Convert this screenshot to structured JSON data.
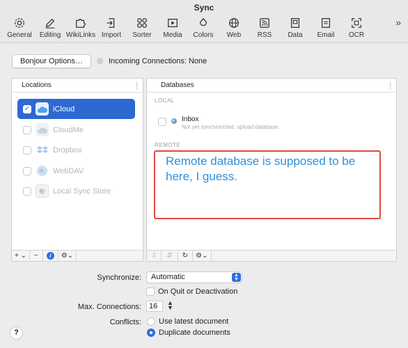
{
  "window": {
    "title": "Sync"
  },
  "toolbar": {
    "items": [
      {
        "label": "General",
        "icon": "gear-icon"
      },
      {
        "label": "Editing",
        "icon": "pen-icon"
      },
      {
        "label": "WikiLinks",
        "icon": "puzzle-icon"
      },
      {
        "label": "Import",
        "icon": "import-icon"
      },
      {
        "label": "Sorter",
        "icon": "sorter-icon"
      },
      {
        "label": "Media",
        "icon": "film-icon"
      },
      {
        "label": "Colors",
        "icon": "paint-icon"
      },
      {
        "label": "Web",
        "icon": "globe-icon"
      },
      {
        "label": "RSS",
        "icon": "rss-icon"
      },
      {
        "label": "Data",
        "icon": "data-icon"
      },
      {
        "label": "Email",
        "icon": "envelope-icon"
      },
      {
        "label": "OCR",
        "icon": "ocr-icon"
      }
    ],
    "more": "»"
  },
  "bonjour": {
    "button_label": "Bonjour Options…",
    "incoming_label": "Incoming Connections: None"
  },
  "locations": {
    "header": "Locations",
    "items": [
      {
        "label": "iCloud",
        "checked": true,
        "selected": true,
        "enabled": true,
        "icon": "icloud-icon"
      },
      {
        "label": "CloudMe",
        "checked": false,
        "selected": false,
        "enabled": false,
        "icon": "cloudme-icon"
      },
      {
        "label": "Dropbox",
        "checked": false,
        "selected": false,
        "enabled": false,
        "icon": "dropbox-icon"
      },
      {
        "label": "WebDAV",
        "checked": false,
        "selected": false,
        "enabled": false,
        "icon": "webdav-icon"
      },
      {
        "label": "Local Sync Store",
        "checked": false,
        "selected": false,
        "enabled": false,
        "icon": "local-store-icon"
      }
    ],
    "footer": {
      "add": "+ ⌄",
      "remove": "−",
      "info": "i",
      "action": "⚙⌄"
    }
  },
  "databases": {
    "header": "Databases",
    "local_label": "LOCAL",
    "remote_label": "REMOTE",
    "local_items": [
      {
        "title": "Inbox",
        "subtitle": "Not yet synchronized, upload database."
      }
    ],
    "annotation": "Remote database is supposed to be here, I guess.",
    "footer": {
      "a": "⇩",
      "b": "⇵",
      "refresh": "↻",
      "action": "⚙⌄"
    }
  },
  "settings": {
    "synchronize_label": "Synchronize:",
    "synchronize_value": "Automatic",
    "on_quit_label": "On Quit or Deactivation",
    "max_connections_label": "Max. Connections:",
    "max_connections_value": "16",
    "conflicts_label": "Conflicts:",
    "conflict_options": [
      {
        "label": "Use latest document",
        "selected": false
      },
      {
        "label": "Duplicate documents",
        "selected": true
      }
    ]
  },
  "help": {
    "label": "?"
  },
  "colors": {
    "accent": "#2e68d1",
    "annotation_border": "#e04a3f",
    "annotation_text": "#2f8fd8"
  }
}
